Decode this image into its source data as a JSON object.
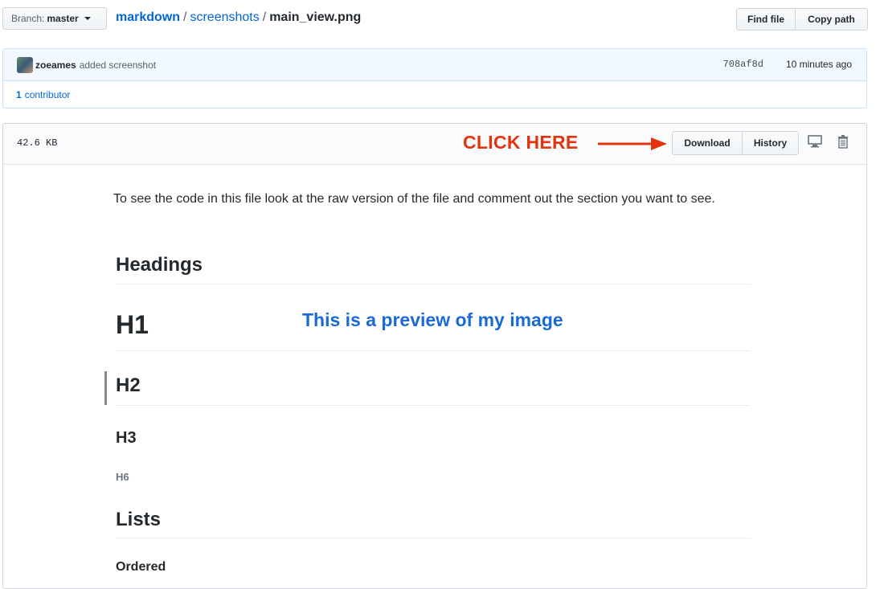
{
  "topbar": {
    "branch_label": "Branch:",
    "branch_value": "master",
    "breadcrumb": {
      "repo": "markdown",
      "sep": "/",
      "folder": "screenshots",
      "file": "main_view.png"
    },
    "find_file": "Find file",
    "copy_path": "Copy path"
  },
  "commit": {
    "author": "zoeames",
    "message": "added screenshot",
    "sha": "708af8d",
    "time": "10 minutes ago",
    "contributors_count": "1",
    "contributors_label": "contributor"
  },
  "file": {
    "size": "42.6 KB",
    "annotation": "CLICK HERE",
    "download": "Download",
    "history": "History",
    "annotation_color": "#e1340f"
  },
  "preview": {
    "intro": "To see the code in this file look at the raw version of the file and comment out the section you want to see.",
    "headings_title": "Headings",
    "h1": "H1",
    "note": "This is a preview of my image",
    "h2": "H2",
    "h3": "H3",
    "h6": "H6",
    "lists_title": "Lists",
    "ordered": "Ordered"
  },
  "icons": [
    "caret-down-icon",
    "avatar",
    "display-icon",
    "trash-icon",
    "arrow-right-icon"
  ]
}
